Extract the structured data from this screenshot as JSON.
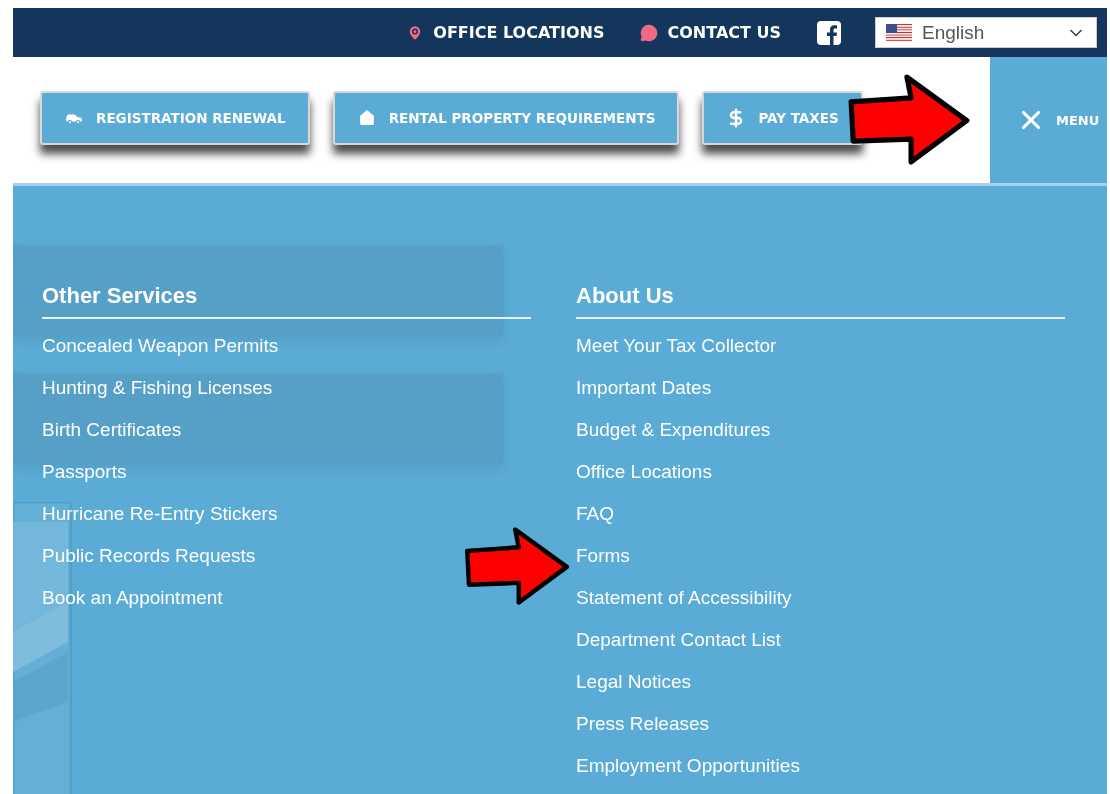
{
  "top_bar": {
    "links": [
      {
        "label": "OFFICE LOCATIONS"
      },
      {
        "label": "CONTACT US"
      }
    ],
    "language": {
      "value": "English"
    }
  },
  "quick_buttons": [
    {
      "label": "REGISTRATION RENEWAL"
    },
    {
      "label": "RENTAL PROPERTY REQUIREMENTS"
    },
    {
      "label": "PAY TAXES"
    }
  ],
  "menu_button": {
    "label": "MENU",
    "expanded": true
  },
  "menu_columns": [
    {
      "heading": "Other Services",
      "items": [
        "Concealed Weapon Permits",
        "Hunting & Fishing Licenses",
        "Birth Certificates",
        "Passports",
        "Hurricane Re-Entry Stickers",
        "Public Records Requests",
        "Book an Appointment"
      ]
    },
    {
      "heading": "About Us",
      "items": [
        "Meet Your Tax Collector",
        "Important Dates",
        "Budget & Expenditures",
        "Office Locations",
        "FAQ",
        "Forms",
        "Statement of Accessibility",
        "Department Contact List",
        "Legal Notices",
        "Press Releases",
        "Employment Opportunities"
      ]
    }
  ]
}
